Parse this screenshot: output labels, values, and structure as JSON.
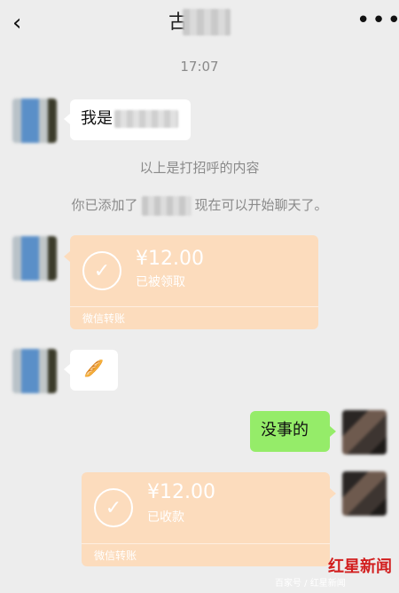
{
  "header": {
    "back_glyph": "‹",
    "title_visible_char": "古",
    "more_glyph": "•••"
  },
  "time": "17:07",
  "messages": [
    {
      "side": "left",
      "type": "text",
      "text": "我是"
    },
    {
      "side": "left",
      "type": "transfer",
      "amount": "¥12.00",
      "status": "已被领取",
      "footer": "微信转账"
    },
    {
      "side": "left",
      "type": "emoji",
      "text": "🥖"
    },
    {
      "side": "right",
      "type": "text",
      "text": "没事的"
    },
    {
      "side": "right",
      "type": "transfer",
      "amount": "¥12.00",
      "status": "已收款",
      "footer": "微信转账"
    }
  ],
  "system": {
    "greeting_note": "以上是打招呼的内容",
    "added_prefix": "你已添加了",
    "added_suffix": "现在可以开始聊天了。"
  },
  "watermark": {
    "text": "百家号 / 红星新闻",
    "logo": "红星新闻"
  },
  "colors": {
    "background": "#ededed",
    "green_bubble": "#95ec69",
    "transfer_bg": "#fcdcbd",
    "system_text": "#8a8a8a",
    "logo_red": "#d21f1f"
  }
}
